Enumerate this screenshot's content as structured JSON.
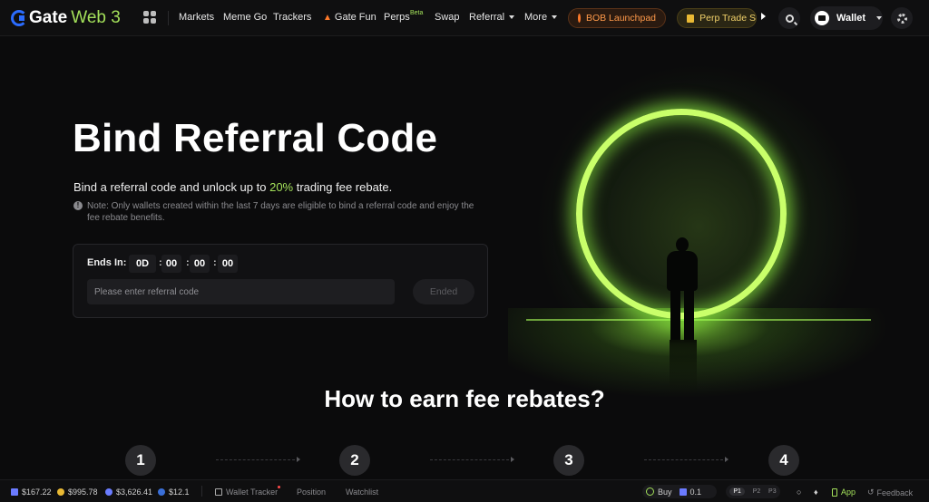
{
  "nav": {
    "logo_text": "Gate",
    "logo_suffix": "Web 3",
    "items": [
      "Markets",
      "Meme Go",
      "Trackers",
      "Gate Fun",
      "Perps",
      "Swap",
      "Referral",
      "More"
    ],
    "perps_badge": "Beta",
    "launchpad_label": "BOB Launchpad",
    "perp_label": "Perp Trade S",
    "wallet_label": "Wallet"
  },
  "hero": {
    "title": "Bind Referral Code",
    "subtitle_pre": "Bind a referral code and unlock up to ",
    "subtitle_highlight": "20%",
    "subtitle_post": " trading fee rebate.",
    "note": "Note: Only wallets created within the last 7 days are eligible to bind a referral code and enjoy the fee rebate benefits.",
    "accent_color": "#a3e05a"
  },
  "countdown": {
    "label": "Ends In:",
    "days": "0D",
    "hours": "00",
    "minutes": "00",
    "seconds": "00"
  },
  "referral": {
    "placeholder": "Please enter referral code",
    "button_label": "Ended"
  },
  "how": {
    "title": "How to earn fee rebates?",
    "steps": [
      "1",
      "2",
      "3",
      "4"
    ]
  },
  "bottom": {
    "prices": [
      "$167.22",
      "$995.78",
      "$3,626.41",
      "$12.1"
    ],
    "wallet_tracker": "Wallet Tracker",
    "position": "Position",
    "watchlist": "Watchlist",
    "buy_label": "Buy",
    "buy_amount": "0.1",
    "presets": [
      "P1",
      "P2",
      "P3"
    ],
    "app_label": "App",
    "feedback_label": "Feedback"
  }
}
